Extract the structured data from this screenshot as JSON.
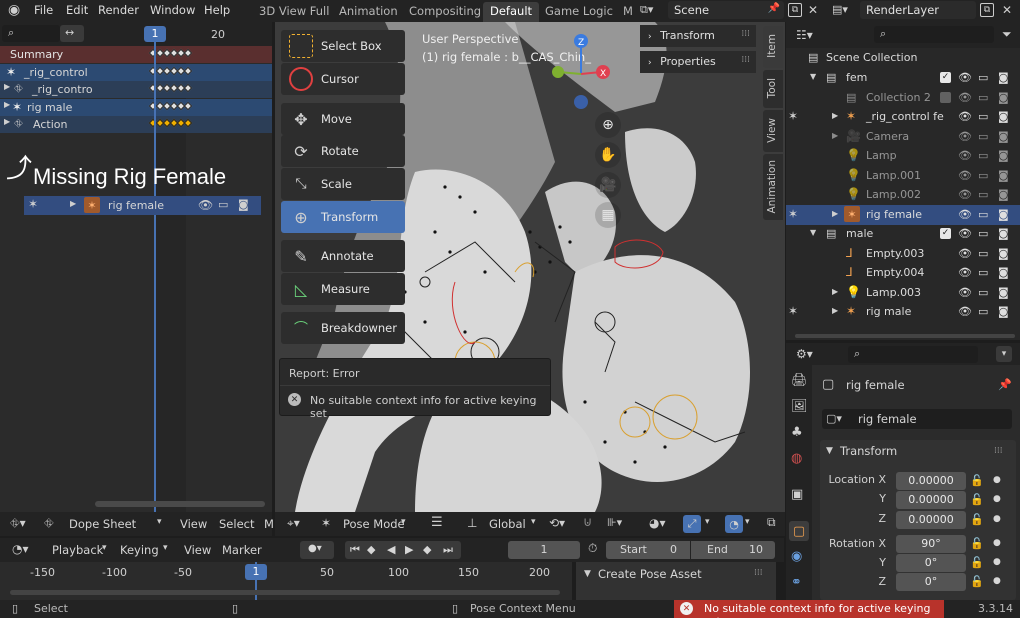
{
  "topbar": {
    "menus": [
      "File",
      "Edit",
      "Render",
      "Window",
      "Help"
    ],
    "workspaces": [
      "3D View Full",
      "Animation",
      "Compositing",
      "Default",
      "Game Logic",
      "M"
    ],
    "active_workspace": "Default",
    "scene": "Scene",
    "render_layer": "RenderLayer"
  },
  "dopesheet": {
    "current_frame": "1",
    "frame_20": "20",
    "rows": [
      {
        "label": "Summary",
        "type": "summary"
      },
      {
        "label": "_rig_control",
        "type": "object"
      },
      {
        "label": "_rig_contro",
        "type": "action"
      },
      {
        "label": "rig male",
        "type": "object"
      },
      {
        "label": "Action",
        "type": "action"
      }
    ],
    "annotation": "Missing Rig Female",
    "drag_row": "rig female",
    "editor_type": "Dope Sheet",
    "menu_view": "View",
    "menu_select": "Select",
    "menu_m": "M"
  },
  "viewport": {
    "perspective": "User Perspective",
    "object_info": "(1) rig female : b__CAS_Chin_",
    "tools": [
      {
        "label": "Select Box",
        "icon": "select-box-icon"
      },
      {
        "label": "Cursor",
        "icon": "cursor-icon"
      },
      {
        "label": "Move",
        "icon": "move-icon"
      },
      {
        "label": "Rotate",
        "icon": "rotate-icon"
      },
      {
        "label": "Scale",
        "icon": "scale-icon"
      },
      {
        "label": "Transform",
        "icon": "transform-icon"
      },
      {
        "label": "Annotate",
        "icon": "annotate-icon"
      },
      {
        "label": "Measure",
        "icon": "measure-icon"
      },
      {
        "label": "Breakdowner",
        "icon": "breakdowner-icon"
      }
    ],
    "active_tool": "Transform",
    "npanel": [
      "Transform",
      "Properties"
    ],
    "side_tabs": [
      "Item",
      "Tool",
      "View",
      "Animation"
    ],
    "report_title": "Report: Error",
    "report_msg": "No suitable context info for active keying set",
    "mode": "Pose Mode",
    "orientation": "Global"
  },
  "outliner": {
    "search_placeholder": "",
    "rows": [
      {
        "label": "Scene Collection",
        "indent": 0
      },
      {
        "label": "fem",
        "indent": 1
      },
      {
        "label": "Collection 2",
        "indent": 2
      },
      {
        "label": "_rig_control fe",
        "indent": 2
      },
      {
        "label": "Camera",
        "indent": 2
      },
      {
        "label": "Lamp",
        "indent": 2
      },
      {
        "label": "Lamp.001",
        "indent": 2
      },
      {
        "label": "Lamp.002",
        "indent": 2
      },
      {
        "label": "rig female",
        "indent": 2,
        "selected": true
      },
      {
        "label": "male",
        "indent": 1
      },
      {
        "label": "Empty.003",
        "indent": 2
      },
      {
        "label": "Empty.004",
        "indent": 2
      },
      {
        "label": "Lamp.003",
        "indent": 2
      },
      {
        "label": "rig male",
        "indent": 2
      }
    ]
  },
  "properties": {
    "object_name": "rig female",
    "data_name": "rig female",
    "section": "Transform",
    "location_label": "Location X",
    "rotation_label": "Rotation X",
    "y_label": "Y",
    "z_label": "Z",
    "loc_x": "0.00000",
    "loc_y": "0.00000",
    "loc_z": "0.00000",
    "rot_x": "90°",
    "rot_y": "0°",
    "rot_z": "0°"
  },
  "timeline": {
    "playback": "Playback",
    "keying": "Keying",
    "view": "View",
    "marker": "Marker",
    "current_frame": "1",
    "start_label": "Start",
    "start_value": "0",
    "end_label": "End",
    "end_value": "10",
    "ticks": [
      "-150",
      "-100",
      "-50",
      "1",
      "50",
      "100",
      "150",
      "200"
    ],
    "create_pose_asset": "Create Pose Asset"
  },
  "statusbar": {
    "select": "Select",
    "pose_context": "Pose Context Menu",
    "error": "No suitable context info for active keying set",
    "version": "3.3.14"
  },
  "colors": {
    "accent": "#4772b3",
    "selected_row": "#334d80",
    "error": "#c0392b",
    "keyframe_yellow": "#f0b000"
  }
}
